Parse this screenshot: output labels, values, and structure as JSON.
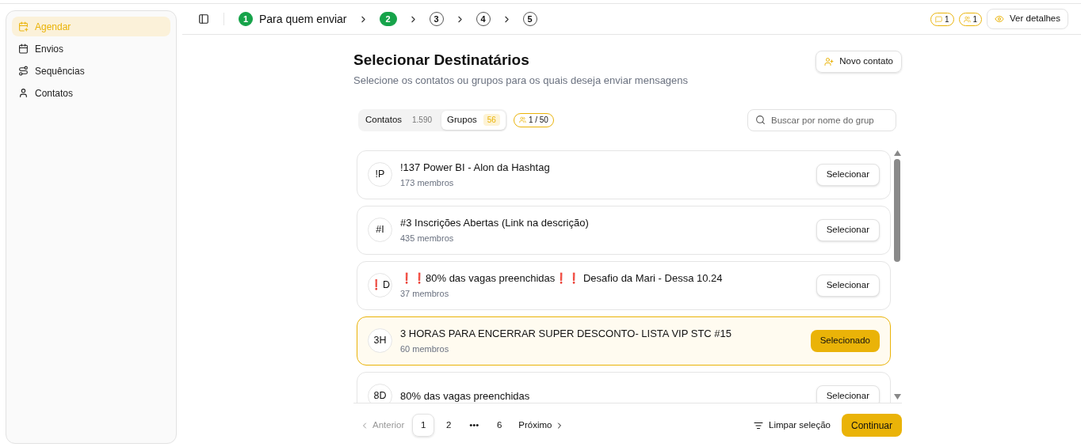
{
  "sidebar": {
    "items": [
      {
        "label": "Agendar",
        "selected": true
      },
      {
        "label": "Envios",
        "selected": false
      },
      {
        "label": "Sequências",
        "selected": false
      },
      {
        "label": "Contatos",
        "selected": false
      }
    ]
  },
  "steps": [
    {
      "number": "1",
      "label": "Para quem enviar",
      "done": true
    },
    {
      "number": "2",
      "done": true
    },
    {
      "number": "3",
      "done": false
    },
    {
      "number": "4",
      "done": false
    },
    {
      "number": "5",
      "done": false
    }
  ],
  "header_badges": [
    {
      "count": "1"
    },
    {
      "count": "1"
    }
  ],
  "details_button": "Ver detalhes",
  "title": "Selecionar Destinatários",
  "subtitle": "Selecione os contatos ou grupos para os quais deseja enviar mensagens",
  "new_contact_button": "Novo contato",
  "tabs": [
    {
      "label": "Contatos",
      "count": "1.590",
      "selected": false
    },
    {
      "label": "Grupos",
      "count": "56",
      "selected": true
    }
  ],
  "selection_limit": "1 / 50",
  "search": {
    "placeholder": "Buscar por nome do grup"
  },
  "groups": [
    {
      "initials": "!P",
      "name": "!137 Power BI - Alon da Hashtag",
      "members": "173 membros",
      "selected": false,
      "action": "Selecionar"
    },
    {
      "initials": "#I",
      "name": "#3 Inscrições Abertas (Link na descrição)",
      "members": "435 membros",
      "selected": false,
      "action": "Selecionar"
    },
    {
      "initials": "❗D",
      "name": "❗❗80% das vagas preenchidas❗❗ Desafio da Mari - Dessa 10.24",
      "members": "37 membros",
      "selected": false,
      "action": "Selecionar"
    },
    {
      "initials": "3H",
      "name": "3 HORAS PARA ENCERRAR SUPER DESCONTO- LISTA VIP STC #15",
      "members": "60 membros",
      "selected": true,
      "action": "Selecionado"
    },
    {
      "initials": "8D",
      "name": "80% das vagas preenchidas",
      "selected": false,
      "action": "Selecionar"
    }
  ],
  "pagination": {
    "previous": "Anterior",
    "pages": [
      {
        "label": "1",
        "selected": true
      },
      {
        "label": "2",
        "selected": false
      },
      {
        "label": "•••",
        "selected": false
      },
      {
        "label": "6",
        "selected": false
      }
    ],
    "next": "Próximo"
  },
  "clear_button": "Limpar seleção",
  "continue_button": "Continuar"
}
